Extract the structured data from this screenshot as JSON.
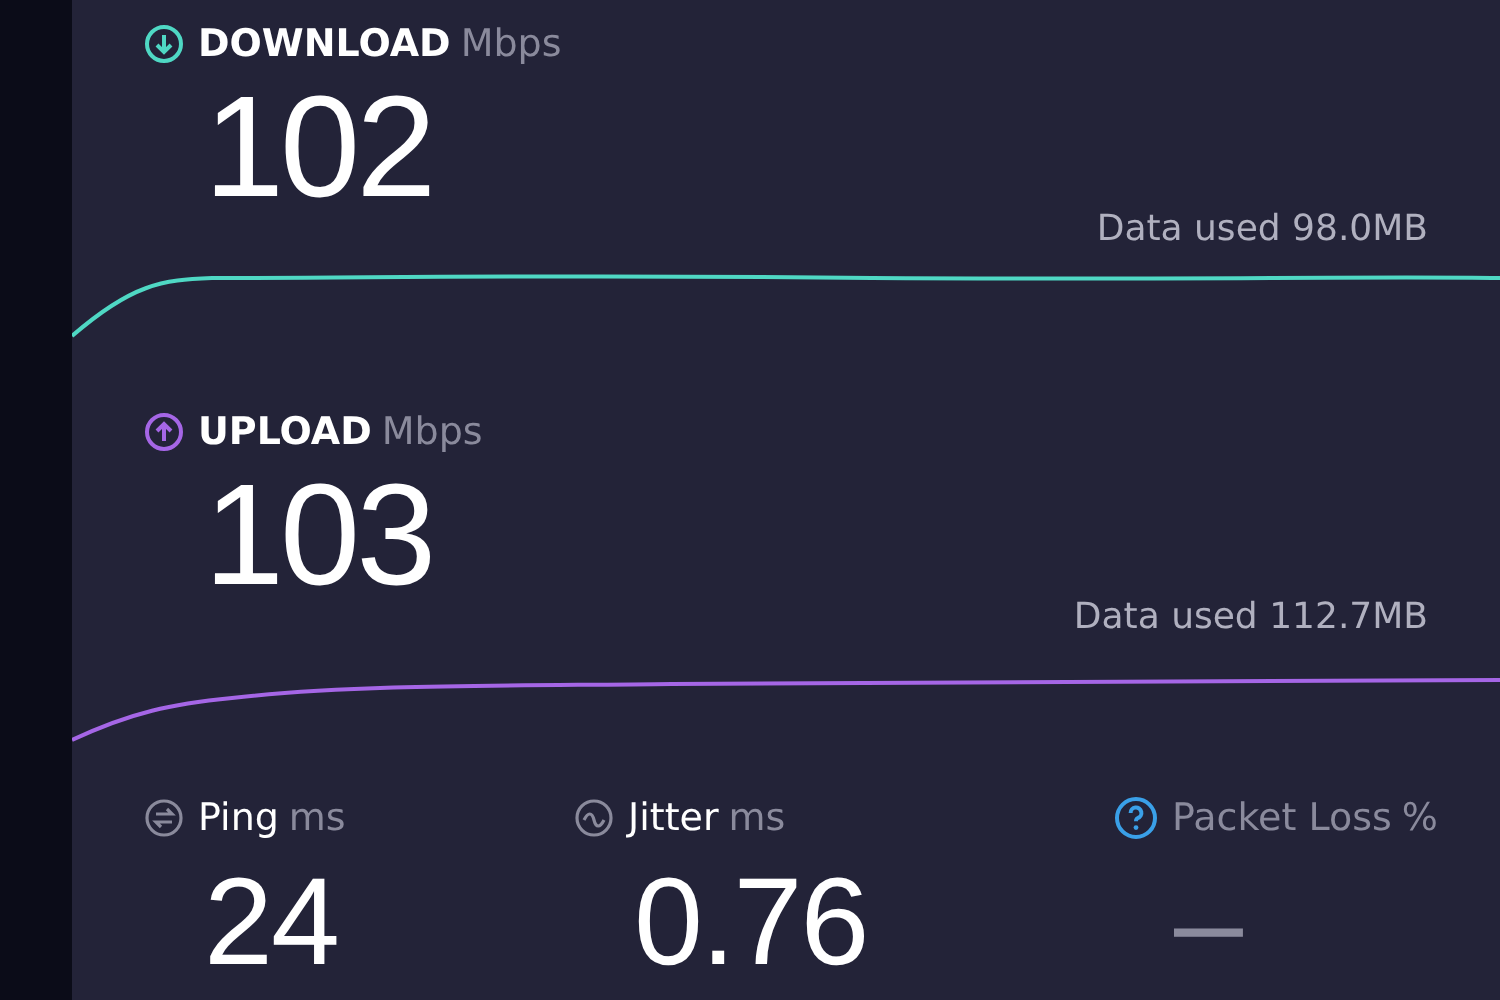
{
  "speeds": [
    {
      "kind": "download",
      "label": "DOWNLOAD",
      "unit": "Mbps",
      "value": "102",
      "data_used": "Data used 98.0MB",
      "color": "#4fd8c4"
    },
    {
      "kind": "upload",
      "label": "UPLOAD",
      "unit": "Mbps",
      "value": "103",
      "data_used": "Data used 112.7MB",
      "color": "#a566e6"
    }
  ],
  "stats": [
    {
      "kind": "ping",
      "label": "Ping",
      "unit": "ms",
      "value": "24"
    },
    {
      "kind": "jitter",
      "label": "Jitter",
      "unit": "ms",
      "value": "0.76"
    },
    {
      "kind": "packet_loss",
      "label": "Packet Loss",
      "unit": "%",
      "value": "–"
    }
  ]
}
